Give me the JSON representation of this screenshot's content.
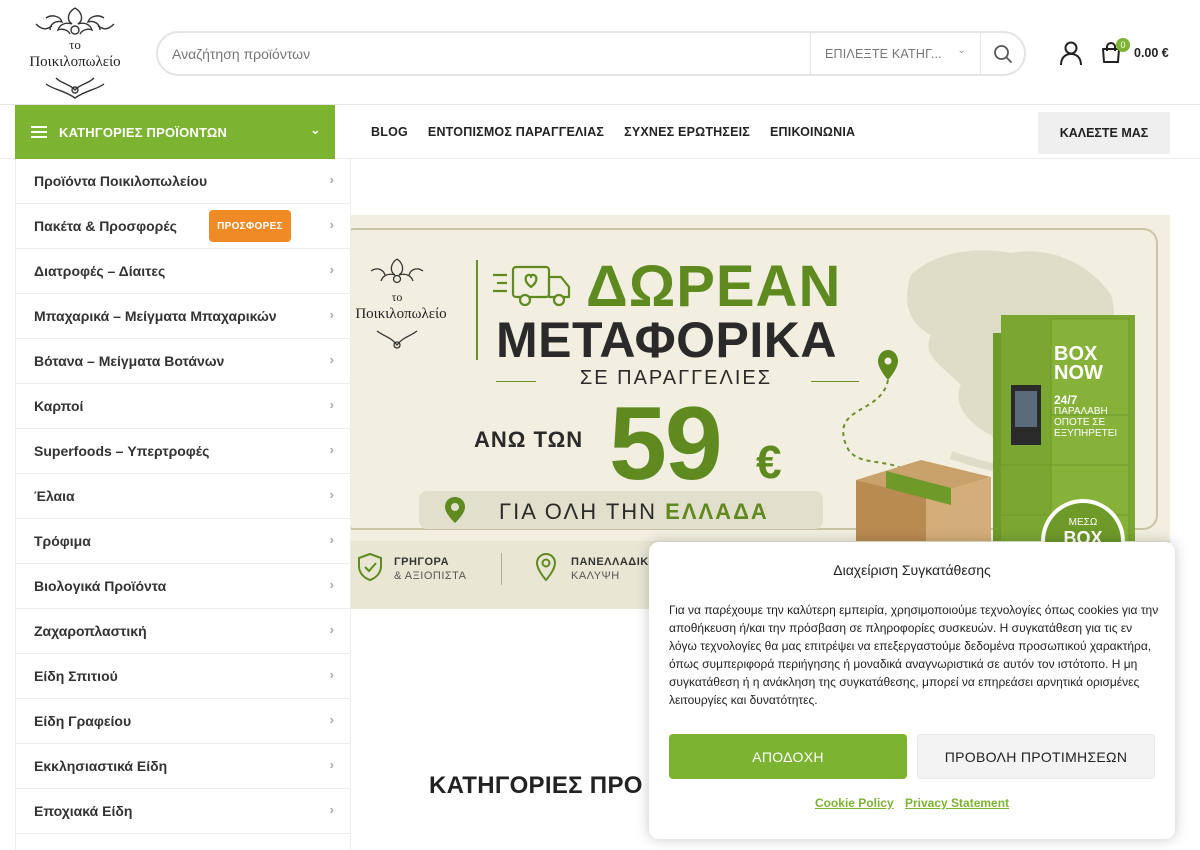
{
  "header": {
    "logo_line1": "το",
    "logo_line2": "Ποικιλοπωλείο",
    "search": {
      "placeholder": "Αναζήτηση προϊόντων",
      "category_label": "ΕΠΙΛΕΞΤΕ ΚΑΤΗΓ...",
      "icon": "search-icon"
    },
    "account_icon": "user-icon",
    "cart": {
      "icon": "shopping-bag-icon",
      "count": "0",
      "total": "0.00 €"
    }
  },
  "nav": {
    "categories_label": "ΚΑΤΗΓΟΡΙΕΣ ΠΡΟΪΟΝΤΩΝ",
    "links": [
      "BLOG",
      "ΕΝΤΟΠΙΣΜΟΣ ΠΑΡΑΓΓΕΛΙΑΣ",
      "ΣΥΧΝΕΣ ΕΡΩΤΗΣΕΙΣ",
      "ΕΠΙΚΟΙΝΩΝΙΑ"
    ],
    "call_button": "ΚΑΛΕΣΤΕ ΜΑΣ"
  },
  "sidebar": {
    "items": [
      {
        "label": "Προϊόντα Ποικιλοπωλείου"
      },
      {
        "label": "Πακέτα & Προσφορές",
        "badge": "ΠΡΟΣΦΟΡΕΣ"
      },
      {
        "label": "Διατροφές – Δίαιτες"
      },
      {
        "label": "Μπαχαρικά – Μείγματα Μπαχαρικών"
      },
      {
        "label": "Βότανα – Μείγματα Βοτάνων"
      },
      {
        "label": "Καρποί"
      },
      {
        "label": "Superfoods – Υπερτροφές"
      },
      {
        "label": "Έλαια"
      },
      {
        "label": "Τρόφιμα"
      },
      {
        "label": "Βιολογικά Προϊόντα"
      },
      {
        "label": "Ζαχαροπλαστική"
      },
      {
        "label": "Είδη Σπιτιού"
      },
      {
        "label": "Είδη Γραφείου"
      },
      {
        "label": "Εκκλησιαστικά Είδη"
      },
      {
        "label": "Εποχιακά Είδη"
      }
    ]
  },
  "banner": {
    "logo_line1": "το",
    "logo_line2": "Ποικιλοπωλείο",
    "title1": "ΔΩΡΕΑΝ",
    "title2": "ΜΕΤΑΦΟΡΙΚΑ",
    "subtitle": "ΣΕ ΠΑΡΑΓΓΕΛΙΕΣ",
    "above": "ΑΝΩ ΤΩΝ",
    "price": "59",
    "currency": "€",
    "region_pre": "ΓΙΑ ΟΛΗ ΤΗΝ",
    "region": "ΕΛΛΑΔΑ",
    "feature1_title": "ΓΡΗΓΟΡΑ",
    "feature1_sub": "& ΑΞΙΟΠΙΣΤΑ",
    "feature2_title": "ΠΑΝΕΛΛΑΔΙΚ",
    "feature2_sub": "ΚΑΛΥΨΗ",
    "locker_brand1": "BOX",
    "locker_brand2": "NOW",
    "locker_text1": "24/7",
    "locker_text2": "ΠΑΡΑΛΑΒΗ",
    "locker_text3": "ΟΠΟΤΕ ΣΕ",
    "locker_text4": "ΕΞΥΠΗΡΕΤΕΙ",
    "circle_pre": "ΜΕΣΩ",
    "circle_brand": "BOX"
  },
  "section": {
    "title": "ΚΑΤΗΓΟΡΙΕΣ ΠΡΟ"
  },
  "consent": {
    "title": "Διαχείριση Συγκατάθεσης",
    "text": "Για να παρέχουμε την καλύτερη εμπειρία, χρησιμοποιούμε τεχνολογίες όπως cookies για την αποθήκευση ή/και την πρόσβαση σε πληροφορίες συσκευών. Η συγκατάθεση για τις εν λόγω τεχνολογίες θα μας επιτρέψει να επεξεργαστούμε δεδομένα προσωπικού χαρακτήρα, όπως συμπεριφορά περιήγησης ή μοναδικά αναγνωριστικά σε αυτόν τον ιστότοπο. Η μη συγκατάθεση ή η ανάκληση της συγκατάθεσης, μπορεί να επηρεάσει αρνητικά ορισμένες λειτουργίες και δυνατότητες.",
    "accept": "ΑΠΟΔΟΧΗ",
    "preferences": "ΠΡΟΒΟΛΗ ΠΡΟΤΙΜΗΣΕΩΝ",
    "cookie_policy": "Cookie Policy",
    "privacy": "Privacy Statement"
  },
  "colors": {
    "brand_green": "#7cb431",
    "offer_orange": "#f08a24",
    "banner_green": "#5f8a1f"
  }
}
